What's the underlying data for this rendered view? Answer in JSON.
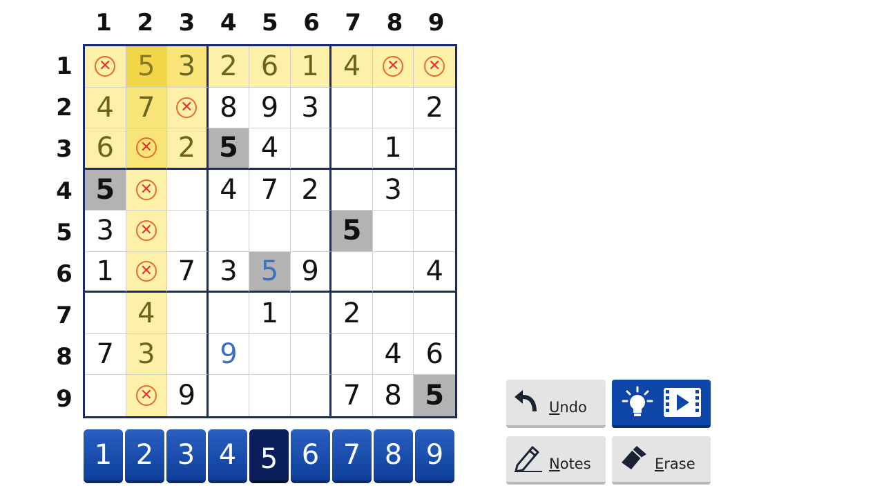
{
  "column_labels": [
    "1",
    "2",
    "3",
    "4",
    "5",
    "6",
    "7",
    "8",
    "9"
  ],
  "row_labels": [
    "1",
    "2",
    "3",
    "4",
    "5",
    "6",
    "7",
    "8",
    "9"
  ],
  "grid": [
    [
      {
        "v": "x",
        "s": "hl"
      },
      {
        "v": "5",
        "s": "hl3"
      },
      {
        "v": "3",
        "s": "hl2"
      },
      {
        "v": "2",
        "s": "hl"
      },
      {
        "v": "6",
        "s": "hl"
      },
      {
        "v": "1",
        "s": "hl"
      },
      {
        "v": "4",
        "s": "hl"
      },
      {
        "v": "x",
        "s": "hl"
      },
      {
        "v": "x",
        "s": "hl"
      }
    ],
    [
      {
        "v": "4",
        "s": "hl"
      },
      {
        "v": "7",
        "s": "hl2"
      },
      {
        "v": "x",
        "s": "hl"
      },
      {
        "v": "8"
      },
      {
        "v": "9"
      },
      {
        "v": "3"
      },
      {
        "v": ""
      },
      {
        "v": ""
      },
      {
        "v": "2"
      }
    ],
    [
      {
        "v": "6",
        "s": "hl"
      },
      {
        "v": "x",
        "s": "hl2"
      },
      {
        "v": "2",
        "s": "hl"
      },
      {
        "v": "5",
        "s": "sel"
      },
      {
        "v": "4"
      },
      {
        "v": ""
      },
      {
        "v": ""
      },
      {
        "v": "1"
      },
      {
        "v": ""
      }
    ],
    [
      {
        "v": "5",
        "s": "sel"
      },
      {
        "v": "x",
        "s": "hl"
      },
      {
        "v": ""
      },
      {
        "v": "4"
      },
      {
        "v": "7"
      },
      {
        "v": "2"
      },
      {
        "v": ""
      },
      {
        "v": "3"
      },
      {
        "v": ""
      }
    ],
    [
      {
        "v": "3"
      },
      {
        "v": "x",
        "s": "hl"
      },
      {
        "v": ""
      },
      {
        "v": ""
      },
      {
        "v": ""
      },
      {
        "v": ""
      },
      {
        "v": "5",
        "s": "sel"
      },
      {
        "v": ""
      },
      {
        "v": ""
      }
    ],
    [
      {
        "v": "1"
      },
      {
        "v": "x",
        "s": "hl"
      },
      {
        "v": "7"
      },
      {
        "v": "3"
      },
      {
        "v": "5",
        "s": "sel",
        "u": true
      },
      {
        "v": "9"
      },
      {
        "v": ""
      },
      {
        "v": ""
      },
      {
        "v": "4"
      }
    ],
    [
      {
        "v": ""
      },
      {
        "v": "4",
        "s": "hl"
      },
      {
        "v": ""
      },
      {
        "v": ""
      },
      {
        "v": "1"
      },
      {
        "v": ""
      },
      {
        "v": "2"
      },
      {
        "v": ""
      },
      {
        "v": ""
      }
    ],
    [
      {
        "v": "7"
      },
      {
        "v": "3",
        "s": "hl"
      },
      {
        "v": ""
      },
      {
        "v": "9",
        "u": true
      },
      {
        "v": ""
      },
      {
        "v": ""
      },
      {
        "v": ""
      },
      {
        "v": "4"
      },
      {
        "v": "6"
      }
    ],
    [
      {
        "v": ""
      },
      {
        "v": "x",
        "s": "hl"
      },
      {
        "v": "9"
      },
      {
        "v": ""
      },
      {
        "v": ""
      },
      {
        "v": ""
      },
      {
        "v": "7"
      },
      {
        "v": "8"
      },
      {
        "v": "5",
        "s": "sel"
      }
    ]
  ],
  "numpad": {
    "keys": [
      "1",
      "2",
      "3",
      "4",
      "5",
      "6",
      "7",
      "8",
      "9"
    ],
    "selected": "5"
  },
  "toolbar": {
    "undo": {
      "underline": "U",
      "rest": "ndo"
    },
    "notes": {
      "underline": "N",
      "rest": "otes"
    },
    "erase": {
      "underline": "E",
      "rest": "rase"
    }
  },
  "icons": {
    "undo": "undo-arrow-icon",
    "notes": "pencil-icon",
    "erase": "eraser-icon",
    "hint": "lightbulb-icon",
    "video": "film-play-icon",
    "mistake": "circle-x-icon"
  },
  "colors": {
    "accent": "#0d45a8",
    "highlight": "#fdf0a8",
    "selected": "#b3b3b3",
    "mistake": "#e8322a",
    "user_digit": "#3b6fc4",
    "border": "#1a2a6c"
  }
}
